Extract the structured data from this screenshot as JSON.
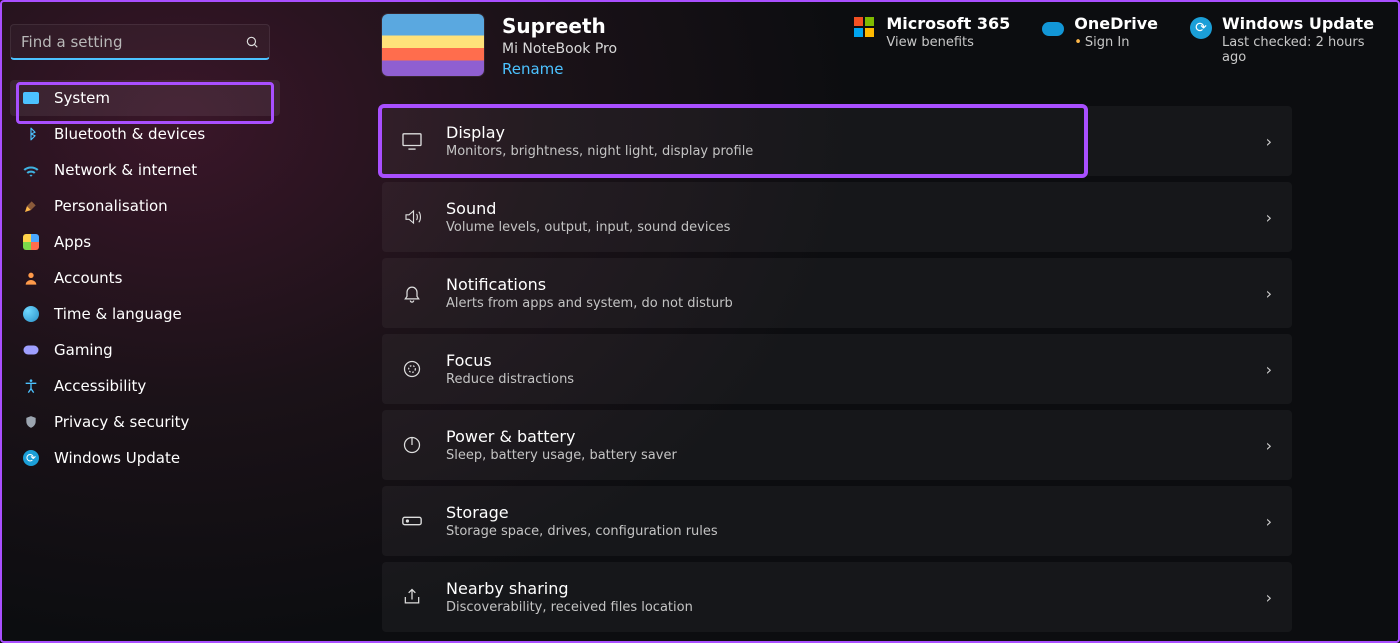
{
  "search": {
    "placeholder": "Find a setting"
  },
  "nav": [
    {
      "label": "System",
      "icon": "system-icon",
      "active": true
    },
    {
      "label": "Bluetooth & devices",
      "icon": "bluetooth-icon"
    },
    {
      "label": "Network & internet",
      "icon": "network-icon"
    },
    {
      "label": "Personalisation",
      "icon": "personalisation-icon"
    },
    {
      "label": "Apps",
      "icon": "apps-icon"
    },
    {
      "label": "Accounts",
      "icon": "accounts-icon"
    },
    {
      "label": "Time & language",
      "icon": "time-language-icon"
    },
    {
      "label": "Gaming",
      "icon": "gaming-icon"
    },
    {
      "label": "Accessibility",
      "icon": "accessibility-icon"
    },
    {
      "label": "Privacy & security",
      "icon": "privacy-icon"
    },
    {
      "label": "Windows Update",
      "icon": "windows-update-icon"
    }
  ],
  "header": {
    "name": "Supreeth",
    "model": "Mi NoteBook Pro",
    "rename": "Rename",
    "cards": [
      {
        "title": "Microsoft 365",
        "sub": "View benefits",
        "icon": "ms365-icon"
      },
      {
        "title": "OneDrive",
        "sub": "Sign In",
        "dot": true,
        "icon": "onedrive-icon"
      },
      {
        "title": "Windows Update",
        "sub": "Last checked: 2 hours ago",
        "icon": "windows-update-status-icon"
      }
    ]
  },
  "rows": [
    {
      "title": "Display",
      "sub": "Monitors, brightness, night light, display profile",
      "icon": "display-icon"
    },
    {
      "title": "Sound",
      "sub": "Volume levels, output, input, sound devices",
      "icon": "sound-icon"
    },
    {
      "title": "Notifications",
      "sub": "Alerts from apps and system, do not disturb",
      "icon": "notifications-icon"
    },
    {
      "title": "Focus",
      "sub": "Reduce distractions",
      "icon": "focus-icon"
    },
    {
      "title": "Power & battery",
      "sub": "Sleep, battery usage, battery saver",
      "icon": "power-icon"
    },
    {
      "title": "Storage",
      "sub": "Storage space, drives, configuration rules",
      "icon": "storage-icon"
    },
    {
      "title": "Nearby sharing",
      "sub": "Discoverability, received files location",
      "icon": "share-icon"
    }
  ],
  "highlight_color": "#a94fff"
}
